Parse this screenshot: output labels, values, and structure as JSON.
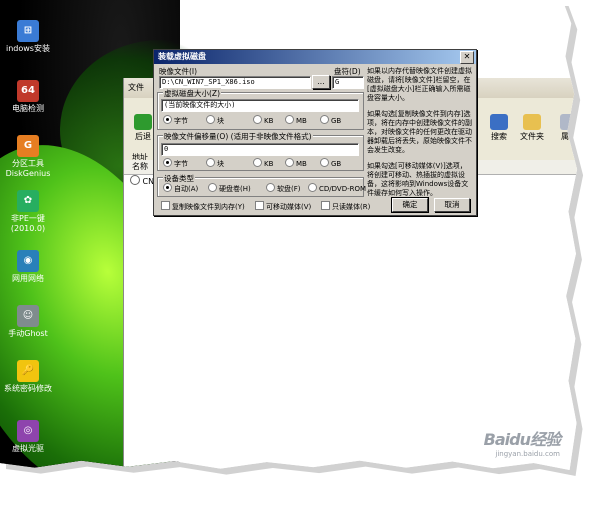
{
  "desktop": {
    "icons": [
      {
        "label": "indows安装",
        "color": "#3a7bd5",
        "glyph": "⊞",
        "name": "windows-setup-icon"
      },
      {
        "label": "电脑检测",
        "color": "#c0392b",
        "glyph": "64",
        "name": "pc-check-icon"
      },
      {
        "label": "分区工具\nDiskGenius",
        "color": "#e67e22",
        "glyph": "G",
        "name": "diskgenius-icon"
      },
      {
        "label": "非PE一键\n(2010.0)",
        "color": "#27ae60",
        "glyph": "✿",
        "name": "pe-onekey-icon"
      },
      {
        "label": "网用网络",
        "color": "#2980b9",
        "glyph": "◉",
        "name": "network-icon"
      },
      {
        "label": "手动Ghost",
        "color": "#7f8c8d",
        "glyph": "☺",
        "name": "ghost-icon"
      },
      {
        "label": "系统密码修改",
        "color": "#f1c40f",
        "glyph": "🔑",
        "name": "password-tool-icon"
      },
      {
        "label": "虚拟光驱",
        "color": "#8e44ad",
        "glyph": "◎",
        "name": "virtual-drive-icon"
      }
    ]
  },
  "explorer": {
    "title": "文件",
    "back_label": "后退",
    "search_label": "搜索",
    "folders_label": "文件夹",
    "props_label": "属性",
    "address_label": "地址",
    "name_col": "名称",
    "item": "CN"
  },
  "dialog": {
    "title": "装载虚拟磁盘",
    "close": "✕",
    "image_file_label": "映像文件(I)",
    "image_file_value": "D:\\CN_WIN7_SP1_X86.iso",
    "browse_label": "...",
    "drive_letter_label": "盘符(D)",
    "drive_letter_value": "G",
    "vdisk_size_label": "虚拟磁盘大小(Z)",
    "vdisk_size_value": "(当前映像文件的大小)",
    "image_offset_label": "映像文件偏移量(O) (适用于非映像文件格式)",
    "image_offset_value": "0",
    "units": [
      "字节",
      "块",
      "KB",
      "MB",
      "GB"
    ],
    "device_type_label": "设备类型",
    "device_types": [
      "自动(A)",
      "硬盘卷(H)",
      "软盘(F)",
      "CD/DVD-ROM"
    ],
    "checkbox_copy": "复制映像文件到内存(Y)",
    "checkbox_removable": "可移动媒体(V)",
    "checkbox_readonly": "只读媒体(R)",
    "ok_label": "确定",
    "cancel_label": "取消",
    "help_1": "如果以内存代替映像文件创建虚拟磁盘，请将[映像文件]栏留空，在[虚拟磁盘大小]栏正确输入所需磁盘容量大小。",
    "help_2": "如果勾选[复制映像文件到内存]选项，将在内存中创建映像文件的副本，对映像文件的任何更改在驱动器卸载后将丢失，原始映像文件不会发生改变。",
    "help_3": "如果勾选[可移动媒体(V)]选项，将创建可移动、热插拔的虚拟设备，这将影响到Windows设备文件缓存如何写入操作。"
  },
  "watermark": {
    "brand": "Baidu经验",
    "url": "jingyan.baidu.com"
  }
}
